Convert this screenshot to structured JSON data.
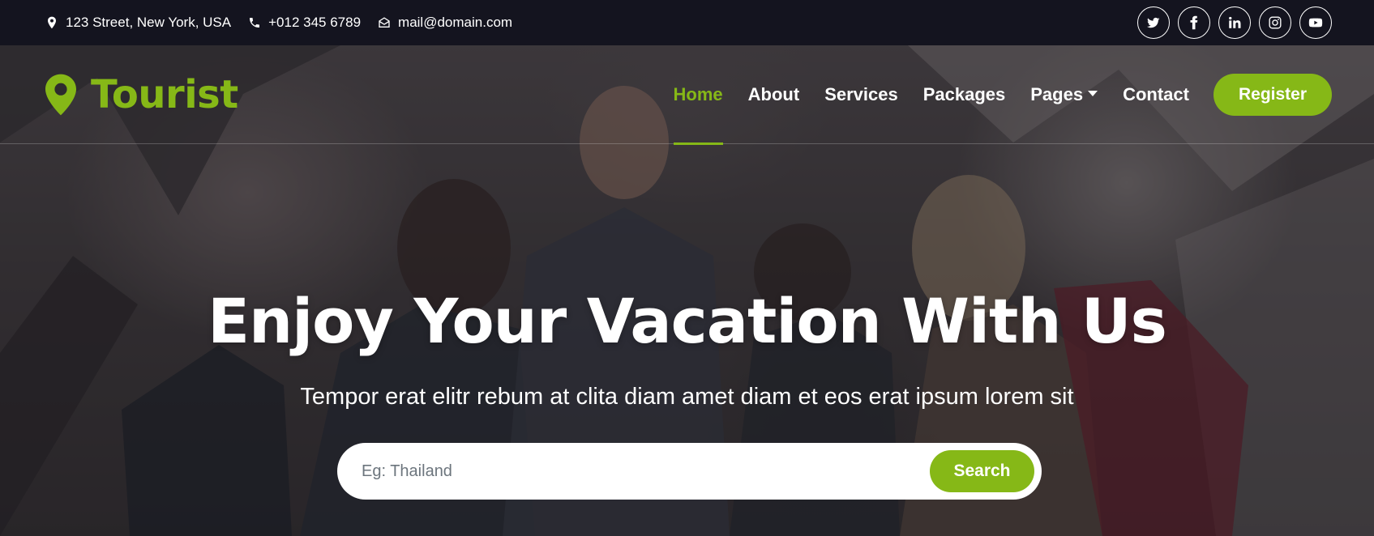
{
  "topbar": {
    "address": "123 Street, New York, USA",
    "phone": "+012 345 6789",
    "email": "mail@domain.com",
    "social": [
      "twitter-icon",
      "facebook-icon",
      "linkedin-icon",
      "instagram-icon",
      "youtube-icon"
    ]
  },
  "brand": {
    "name": "Tourist",
    "color": "#86b817"
  },
  "nav": {
    "items": [
      {
        "label": "Home",
        "active": true
      },
      {
        "label": "About"
      },
      {
        "label": "Services"
      },
      {
        "label": "Packages"
      },
      {
        "label": "Pages",
        "dropdown": true
      },
      {
        "label": "Contact"
      }
    ],
    "register_label": "Register"
  },
  "hero": {
    "title": "Enjoy Your Vacation With Us",
    "subtitle": "Tempor erat elitr rebum at clita diam amet diam et eos erat ipsum lorem sit",
    "search_placeholder": "Eg: Thailand",
    "search_value": "",
    "search_button": "Search"
  },
  "colors": {
    "accent": "#86b817",
    "dark": "#14141f",
    "white": "#ffffff"
  }
}
